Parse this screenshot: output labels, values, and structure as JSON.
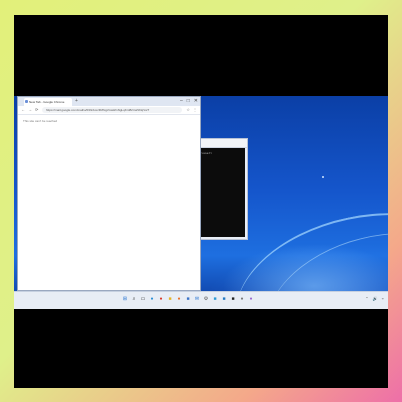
{
  "browser": {
    "tab_title": "New Tab - Google Chrome",
    "new_tab_label": "+",
    "window_controls": [
      "–",
      "□",
      "✕"
    ],
    "nav_icons": [
      "←",
      "→",
      "⟳"
    ],
    "url": "https://mail.google.com/mail/u/0/#inbox/FMfcgzGwHfnNgLqKmBrCsZzDqVwT",
    "menu_icons": [
      "☆",
      "⋮"
    ],
    "content_text": "This site can't be reached"
  },
  "terminal": {
    "prompt": "C:\\Users\\user>"
  },
  "taskbar": {
    "icons": [
      {
        "name": "start-icon",
        "glyph": "⊞",
        "color": "#1f6fd1"
      },
      {
        "name": "search-icon",
        "glyph": "⌕",
        "color": "#333333"
      },
      {
        "name": "task-view-icon",
        "glyph": "▭",
        "color": "#333333"
      },
      {
        "name": "edge-icon",
        "glyph": "●",
        "color": "#2b8fd6"
      },
      {
        "name": "chrome-icon",
        "glyph": "●",
        "color": "#d93b2b"
      },
      {
        "name": "explorer-icon",
        "glyph": "■",
        "color": "#e6b422"
      },
      {
        "name": "firefox-icon",
        "glyph": "●",
        "color": "#e8702a"
      },
      {
        "name": "store-icon",
        "glyph": "■",
        "color": "#3a73c8"
      },
      {
        "name": "mail-icon",
        "glyph": "✉",
        "color": "#1f6fd1"
      },
      {
        "name": "settings-icon",
        "glyph": "⚙",
        "color": "#555555"
      },
      {
        "name": "photos-icon",
        "glyph": "■",
        "color": "#2c9ad6"
      },
      {
        "name": "vscode-icon",
        "glyph": "■",
        "color": "#2479c4"
      },
      {
        "name": "terminal-icon",
        "glyph": "■",
        "color": "#222222"
      },
      {
        "name": "app-icon",
        "glyph": "●",
        "color": "#7a7a7a"
      },
      {
        "name": "app-icon-2",
        "glyph": "●",
        "color": "#9a6ad0"
      }
    ],
    "tray": [
      "⌃",
      "🔊",
      "⌁"
    ]
  }
}
